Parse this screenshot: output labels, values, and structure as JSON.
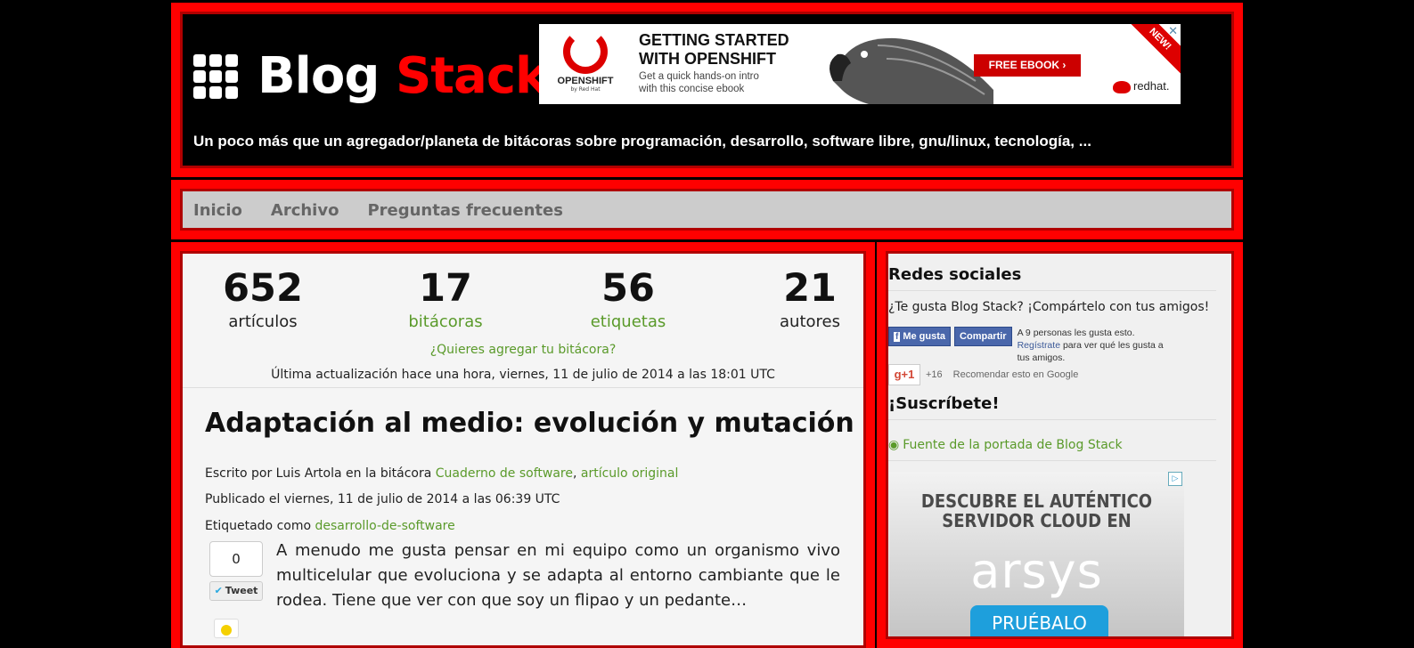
{
  "header": {
    "logo_black": "Blog ",
    "logo_red": "Stack",
    "tagline": "Un poco más que un agregador/planeta de bitácoras sobre programación, desarrollo, software libre, gnu/linux, tecnología, ..."
  },
  "ad_banner": {
    "brand": "OPENSHIFT",
    "brand_sub": "by Red Hat",
    "headline_1": "GETTING STARTED",
    "headline_2": "WITH OPENSHIFT",
    "sub_1": "Get a quick hands-on intro",
    "sub_2": "with this concise ebook",
    "cta": "FREE EBOOK ›",
    "sponsor": "redhat.",
    "new_tag": "NEW!",
    "close": "✕"
  },
  "nav": {
    "items": [
      "Inicio",
      "Archivo",
      "Preguntas frecuentes"
    ]
  },
  "stats": [
    {
      "num": "652",
      "label": "artículos",
      "link": false
    },
    {
      "num": "17",
      "label": "bitácoras",
      "link": true
    },
    {
      "num": "56",
      "label": "etiquetas",
      "link": true
    },
    {
      "num": "21",
      "label": "autores",
      "link": false
    }
  ],
  "add_blog_link": "¿Quieres agregar tu bitácora?",
  "last_update": "Última actualización hace una hora, viernes, 11 de julio de 2014 a las 18:01 UTC",
  "post": {
    "title": "Adaptación al medio: evolución y mutación",
    "written_prefix": "Escrito por Luis Artola en la bitácora ",
    "blog_name": "Cuaderno de software",
    "original_link": "artículo original",
    "published": "Publicado el viernes, 11 de julio de 2014 a las 06:39 UTC",
    "tagged_prefix": "Etiquetado como ",
    "tag": "desarrollo-de-software",
    "excerpt": "A menudo me gusta pensar en mi equipo como un organismo vivo multicelular que evoluciona y se adapta al entorno cambiante que le rodea. Tiene que ver con que soy un flipao y un pedante…",
    "tweet_count": "0",
    "tweet_label": "Tweet"
  },
  "sidebar": {
    "social_heading": "Redes sociales",
    "share_text": "¿Te gusta Blog Stack? ¡Compártelo con tus amigos!",
    "fb_like": "Me gusta",
    "fb_share": "Compartir",
    "fb_text_1": "A 9 personas les gusta esto.",
    "fb_register": "Regístrate",
    "fb_text_2": " para ver qué les gusta a tus amigos.",
    "gplus_label": "g+1",
    "gplus_count": "+16",
    "gplus_text": "Recomendar esto en Google",
    "subscribe_heading": "¡Suscríbete!",
    "rss_link": "Fuente de la portada de Blog Stack"
  },
  "ad_side": {
    "line_1": "DESCUBRE EL AUTÉNTICO",
    "line_2": "SERVIDOR CLOUD EN",
    "brand": "arsys",
    "cta": "PRUÉBALO GRATIS"
  },
  "colors": {
    "frame_red": "#ff0000",
    "link_green": "#5a9a2a",
    "nav_bg": "#cccccc"
  }
}
